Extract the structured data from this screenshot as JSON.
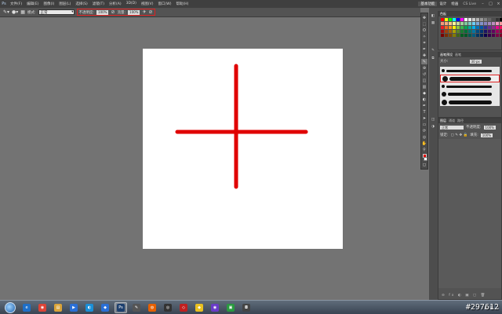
{
  "menubar": {
    "logo": "Ps",
    "items": [
      "文件(F)",
      "编辑(E)",
      "图像(I)",
      "图层(L)",
      "选择(S)",
      "滤镜(T)",
      "分析(A)",
      "3D(D)",
      "视图(V)",
      "窗口(W)",
      "帮助(H)"
    ],
    "workspaces": [
      "基本功能",
      "设计",
      "绘画"
    ],
    "active_workspace": "基本功能",
    "cslive": "CS Live",
    "window_buttons": [
      "–",
      "□",
      "×"
    ]
  },
  "options": {
    "mode_label": "模式:",
    "mode_value": "正常",
    "opacity_label": "不透明度:",
    "opacity_value": "100%",
    "flow_label": "流量:",
    "flow_value": "100%"
  },
  "canvas": {
    "background": "#ffffff",
    "stroke_color": "#e00000"
  },
  "tools": [
    "move",
    "marquee",
    "lasso",
    "quick-select",
    "crop",
    "eyedropper",
    "healing",
    "brush",
    "clone",
    "history",
    "eraser",
    "gradient",
    "blur",
    "dodge",
    "pen",
    "type",
    "path-select",
    "shape",
    "3d-rotate",
    "3d-camera",
    "hand",
    "zoom"
  ],
  "colors": {
    "foreground": "#e00000",
    "background": "#ffffff"
  },
  "swatches_panel": {
    "tabs": [
      "色板"
    ],
    "colors": [
      "#ff0000",
      "#ffff00",
      "#00ff00",
      "#00ffff",
      "#0000ff",
      "#ff00ff",
      "#ffffff",
      "#e6e6e6",
      "#cccccc",
      "#b3b3b3",
      "#999999",
      "#808080",
      "#666666",
      "#4d4d4d",
      "#333333",
      "#000000",
      "#f7977a",
      "#f9ad81",
      "#fdc68a",
      "#fff79a",
      "#c4df9b",
      "#a2d39c",
      "#82ca9d",
      "#7bcdc8",
      "#6ecff6",
      "#7ea7d8",
      "#8493ca",
      "#8882be",
      "#a187be",
      "#bc8dbf",
      "#f49ac2",
      "#f6989d",
      "#ed1c24",
      "#f26522",
      "#f7941d",
      "#fff200",
      "#8dc63f",
      "#39b54a",
      "#00a651",
      "#00a99d",
      "#00aeef",
      "#0072bc",
      "#0054a6",
      "#2e3192",
      "#662d91",
      "#92278f",
      "#ec008c",
      "#ed145b",
      "#9e0b0f",
      "#a0410d",
      "#a36209",
      "#aba000",
      "#598527",
      "#1a7b30",
      "#007236",
      "#00746b",
      "#0076a3",
      "#004b80",
      "#003471",
      "#1b1464",
      "#440e62",
      "#630460",
      "#9e005d",
      "#9e0039",
      "#790000",
      "#7b2e00",
      "#7d4900",
      "#827b00",
      "#406618",
      "#005e20",
      "#005826",
      "#005952",
      "#005b7f",
      "#003663",
      "#002157",
      "#0d004c",
      "#32004b",
      "#4b0049",
      "#7b0046",
      "#7a0026"
    ]
  },
  "brushes_panel": {
    "tabs": [
      "画笔预设",
      "画笔"
    ],
    "size_label": "大小:",
    "size_value": "30 px"
  },
  "layers_panel": {
    "tabs": [
      "图层",
      "通道",
      "路径"
    ],
    "mode_value": "正常",
    "opacity_label": "不透明度:",
    "opacity_value": "100%",
    "fill_label": "填充:",
    "fill_value": "100%",
    "lock_label": "锁定:"
  },
  "taskbar": {
    "apps": [
      {
        "name": "ie",
        "color": "#1e6fc8",
        "glyph": "e"
      },
      {
        "name": "chrome",
        "color": "#db4437",
        "glyph": "◉"
      },
      {
        "name": "explorer",
        "color": "#d9a43a",
        "glyph": "▤"
      },
      {
        "name": "mediaplayer",
        "color": "#2a6fd6",
        "glyph": "▶"
      },
      {
        "name": "qq",
        "color": "#1a8fd8",
        "glyph": "◐"
      },
      {
        "name": "storm",
        "color": "#2a6fd6",
        "glyph": "◆"
      },
      {
        "name": "photoshop",
        "color": "#1c3f6e",
        "glyph": "Ps"
      },
      {
        "name": "pen",
        "color": "#555555",
        "glyph": "✎"
      },
      {
        "name": "firefox",
        "color": "#e66000",
        "glyph": "◍"
      },
      {
        "name": "ball",
        "color": "#333333",
        "glyph": "◎"
      },
      {
        "name": "red-app",
        "color": "#c02020",
        "glyph": "◇"
      },
      {
        "name": "yellow-app",
        "color": "#e8c020",
        "glyph": "◆"
      },
      {
        "name": "360",
        "color": "#6a3cc8",
        "glyph": "◉"
      },
      {
        "name": "green-app",
        "color": "#2a9a40",
        "glyph": "▣"
      },
      {
        "name": "camera",
        "color": "#444444",
        "glyph": "◘"
      }
    ],
    "watermark": "#297612"
  }
}
